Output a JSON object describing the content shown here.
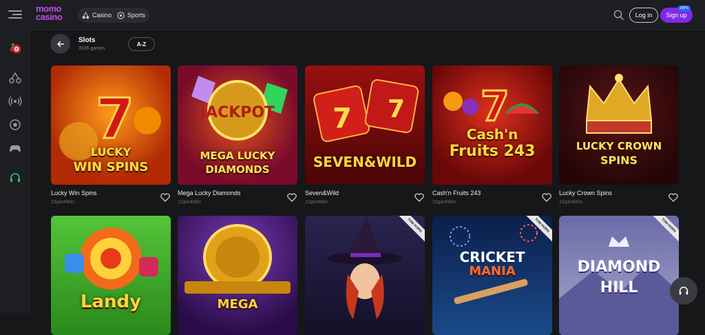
{
  "header": {
    "logo_line1": "momo",
    "logo_line2": "casino",
    "nav": [
      {
        "label": "Casino",
        "icon": "cherry-icon"
      },
      {
        "label": "Sports",
        "icon": "ball-icon"
      }
    ],
    "login_label": "Log in",
    "signup_label": "Sign up",
    "signup_badge": "100%"
  },
  "sidebar": {
    "items": [
      "fruits-icon",
      "cherry-icon",
      "live-icon",
      "soccer-icon",
      "gamepad-icon",
      "headset-icon"
    ]
  },
  "section": {
    "title": "Slots",
    "count": "3035 games",
    "sort_label": "A-Z"
  },
  "games": [
    {
      "name": "Lucky Win Spins",
      "provider": "1Spin4Win",
      "art_line1": "LUCKY",
      "art_line2": "WIN SPINS",
      "bg": "#c0420a"
    },
    {
      "name": "Mega Lucky Diamonds",
      "provider": "1Spin4Win",
      "art_line1": "MEGA LUCKY",
      "art_line2": "DIAMONDS",
      "bg": "#8a1030"
    },
    {
      "name": "Seven&Wild",
      "provider": "1Spin4Win",
      "art_line1": "SEVEN&WILD",
      "art_line2": "",
      "bg": "#7a0d0d"
    },
    {
      "name": "Cash'n Fruits 243",
      "provider": "1Spin4Win",
      "art_line1": "Cash'n",
      "art_line2": "Fruits 243",
      "bg": "#8c0f14"
    },
    {
      "name": "Lucky Crown Spins",
      "provider": "1Spin4Win",
      "art_line1": "LUCKY CROWN",
      "art_line2": "SPINS",
      "bg": "#3d0b10"
    },
    {
      "name": "",
      "provider": "",
      "art_line1": "Landy",
      "art_line2": "",
      "bg": "#3cae2a"
    },
    {
      "name": "",
      "provider": "",
      "art_line1": "MEGA",
      "art_line2": "",
      "bg": "#4a1a6e"
    },
    {
      "name": "",
      "provider": "",
      "art_line1": "",
      "art_line2": "",
      "bg": "#1b1735",
      "tag": "TOM HORN"
    },
    {
      "name": "",
      "provider": "",
      "art_line1": "CRICKET",
      "art_line2": "MANIA",
      "bg": "#0c2350",
      "tag": "TOM HORN"
    },
    {
      "name": "",
      "provider": "",
      "art_line1": "DIAMOND",
      "art_line2": "HILL",
      "bg": "#7f7fb5",
      "tag": "TOM HORN"
    }
  ],
  "colors": {
    "accent": "#7f29e8",
    "background": "#161719",
    "panel": "#1d1e21"
  }
}
